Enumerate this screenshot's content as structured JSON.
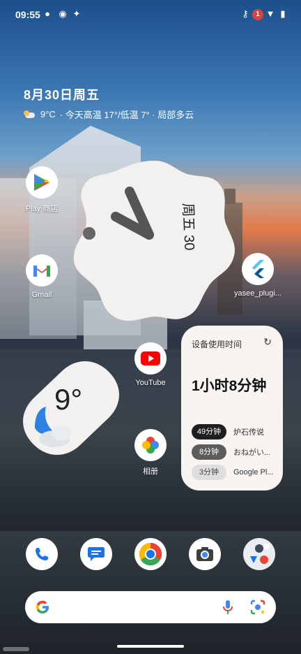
{
  "status_bar": {
    "time": "09:55",
    "notification_count": "1"
  },
  "at_a_glance": {
    "date": "8月30日周五",
    "temp": "9°C",
    "forecast": "· 今天高温 17°/低温 7° · 局部多云"
  },
  "clock_widget": {
    "date_label": "周五 30"
  },
  "apps": [
    {
      "label": "Play 商店",
      "icon": "play-store-icon"
    },
    {
      "label": "Gmail",
      "icon": "gmail-icon"
    },
    {
      "label": "yasee_plugi...",
      "icon": "flutter-icon"
    },
    {
      "label": "YouTube",
      "icon": "youtube-icon"
    },
    {
      "label": "相册",
      "icon": "photos-icon"
    }
  ],
  "weather_widget": {
    "temp": "9°"
  },
  "usage_widget": {
    "title": "设备使用时间",
    "total": "1小时8分钟",
    "rows": [
      {
        "time": "49分钟",
        "app": "炉石传说"
      },
      {
        "time": "8分钟",
        "app": "おねがい..."
      },
      {
        "time": "3分钟",
        "app": "Google Pl..."
      }
    ]
  },
  "dock": [
    "phone-icon",
    "messages-icon",
    "chrome-icon",
    "camera-icon",
    "apps-folder-icon"
  ],
  "colors": {
    "youtube": "#ff0000",
    "play_blue": "#4285f4",
    "gmail_red": "#ea4335",
    "flutter": "#54c5f8"
  }
}
